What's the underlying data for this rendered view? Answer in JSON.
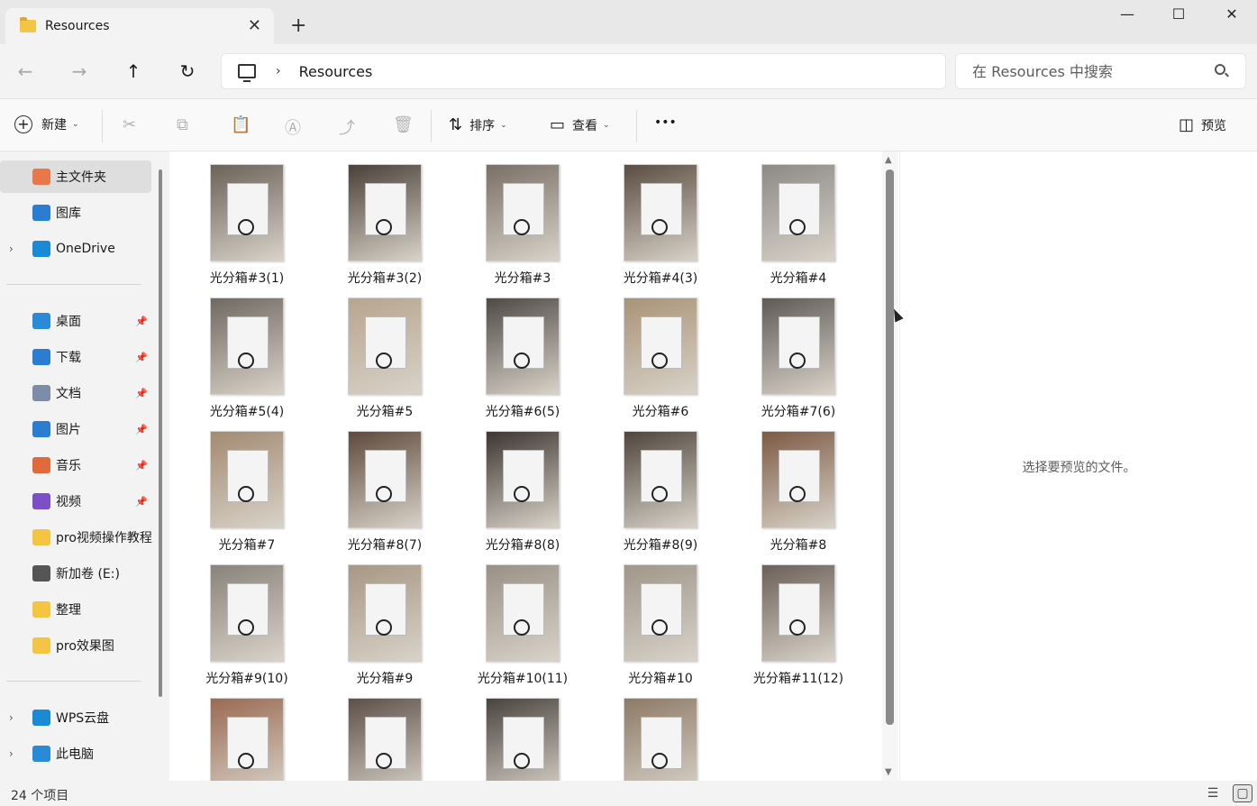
{
  "window": {
    "tab_title": "Resources",
    "tab_close": "✕",
    "new_tab": "+",
    "minimize": "—",
    "maximize": "☐",
    "close": "✕"
  },
  "nav": {
    "back": "←",
    "forward": "→",
    "up": "↑",
    "refresh": "↻",
    "crumb_sep": "›",
    "breadcrumb": "Resources",
    "search_placeholder": "在 Resources 中搜索"
  },
  "toolbar": {
    "new_label": "新建",
    "sort_label": "排序",
    "view_label": "查看",
    "more": "•••",
    "preview_label": "预览",
    "caret": "⌄"
  },
  "sidebar": {
    "items": [
      {
        "label": "主文件夹",
        "icon": "home-icon",
        "color": "#e8774a",
        "active": true,
        "pin": false,
        "chevron": false
      },
      {
        "label": "图库",
        "icon": "gallery-icon",
        "color": "#2b7cd3",
        "active": false,
        "pin": false,
        "chevron": false
      },
      {
        "label": "OneDrive",
        "icon": "cloud-icon",
        "color": "#1b8ad6",
        "active": false,
        "pin": false,
        "chevron": true
      },
      {
        "label": "桌面",
        "icon": "desktop-icon",
        "color": "#2b8ad8",
        "active": false,
        "pin": true,
        "chevron": false
      },
      {
        "label": "下载",
        "icon": "download-icon",
        "color": "#2b7cd3",
        "active": false,
        "pin": true,
        "chevron": false
      },
      {
        "label": "文档",
        "icon": "document-icon",
        "color": "#7d8da8",
        "active": false,
        "pin": true,
        "chevron": false
      },
      {
        "label": "图片",
        "icon": "pictures-icon",
        "color": "#2b7cd3",
        "active": false,
        "pin": true,
        "chevron": false
      },
      {
        "label": "音乐",
        "icon": "music-icon",
        "color": "#e06a3c",
        "active": false,
        "pin": true,
        "chevron": false
      },
      {
        "label": "视频",
        "icon": "video-icon",
        "color": "#7a4fc8",
        "active": false,
        "pin": true,
        "chevron": false
      },
      {
        "label": "pro视频操作教程",
        "icon": "folder-icon",
        "color": "#f4c542",
        "active": false,
        "pin": false,
        "chevron": false
      },
      {
        "label": "新加卷 (E:)",
        "icon": "drive-icon",
        "color": "#555555",
        "active": false,
        "pin": false,
        "chevron": false
      },
      {
        "label": "整理",
        "icon": "folder-icon",
        "color": "#f4c542",
        "active": false,
        "pin": false,
        "chevron": false
      },
      {
        "label": "pro效果图",
        "icon": "folder-icon",
        "color": "#f4c542",
        "active": false,
        "pin": false,
        "chevron": false
      },
      {
        "label": "WPS云盘",
        "icon": "cloud-icon",
        "color": "#1b8ad6",
        "active": false,
        "pin": false,
        "chevron": true
      },
      {
        "label": "此电脑",
        "icon": "computer-icon",
        "color": "#2b8ad8",
        "active": false,
        "pin": false,
        "chevron": true
      }
    ],
    "pin_glyph": "📌",
    "chevron_glyph": "›"
  },
  "files": [
    {
      "name": "光分箱#3(1)",
      "bg": "#6b6258"
    },
    {
      "name": "光分箱#3(2)",
      "bg": "#4a4039"
    },
    {
      "name": "光分箱#3",
      "bg": "#7a6f66"
    },
    {
      "name": "光分箱#4(3)",
      "bg": "#5b4c40"
    },
    {
      "name": "光分箱#4",
      "bg": "#8d8a86"
    },
    {
      "name": "光分箱#5(4)",
      "bg": "#6f6962"
    },
    {
      "name": "光分箱#5",
      "bg": "#b7a58e"
    },
    {
      "name": "光分箱#6(5)",
      "bg": "#4e4a46"
    },
    {
      "name": "光分箱#6",
      "bg": "#a99377"
    },
    {
      "name": "光分箱#7(6)",
      "bg": "#5e5a56"
    },
    {
      "name": "光分箱#7",
      "bg": "#a38a72"
    },
    {
      "name": "光分箱#8(7)",
      "bg": "#5e4a3c"
    },
    {
      "name": "光分箱#8(8)",
      "bg": "#3d3631"
    },
    {
      "name": "光分箱#8(9)",
      "bg": "#4f453d"
    },
    {
      "name": "光分箱#8",
      "bg": "#7d5a44"
    },
    {
      "name": "光分箱#9(10)",
      "bg": "#8a837b"
    },
    {
      "name": "光分箱#9",
      "bg": "#a89784"
    },
    {
      "name": "光分箱#10(11)",
      "bg": "#9a9186"
    },
    {
      "name": "光分箱#10",
      "bg": "#a0968a"
    },
    {
      "name": "光分箱#11(12)",
      "bg": "#6c6058"
    },
    {
      "name": "",
      "bg": "#9a6a52"
    },
    {
      "name": "",
      "bg": "#5d5048"
    },
    {
      "name": "",
      "bg": "#4a4440"
    },
    {
      "name": "",
      "bg": "#8e7a66"
    }
  ],
  "preview": {
    "message": "选择要预览的文件。"
  },
  "status": {
    "count": "24 个项目"
  }
}
